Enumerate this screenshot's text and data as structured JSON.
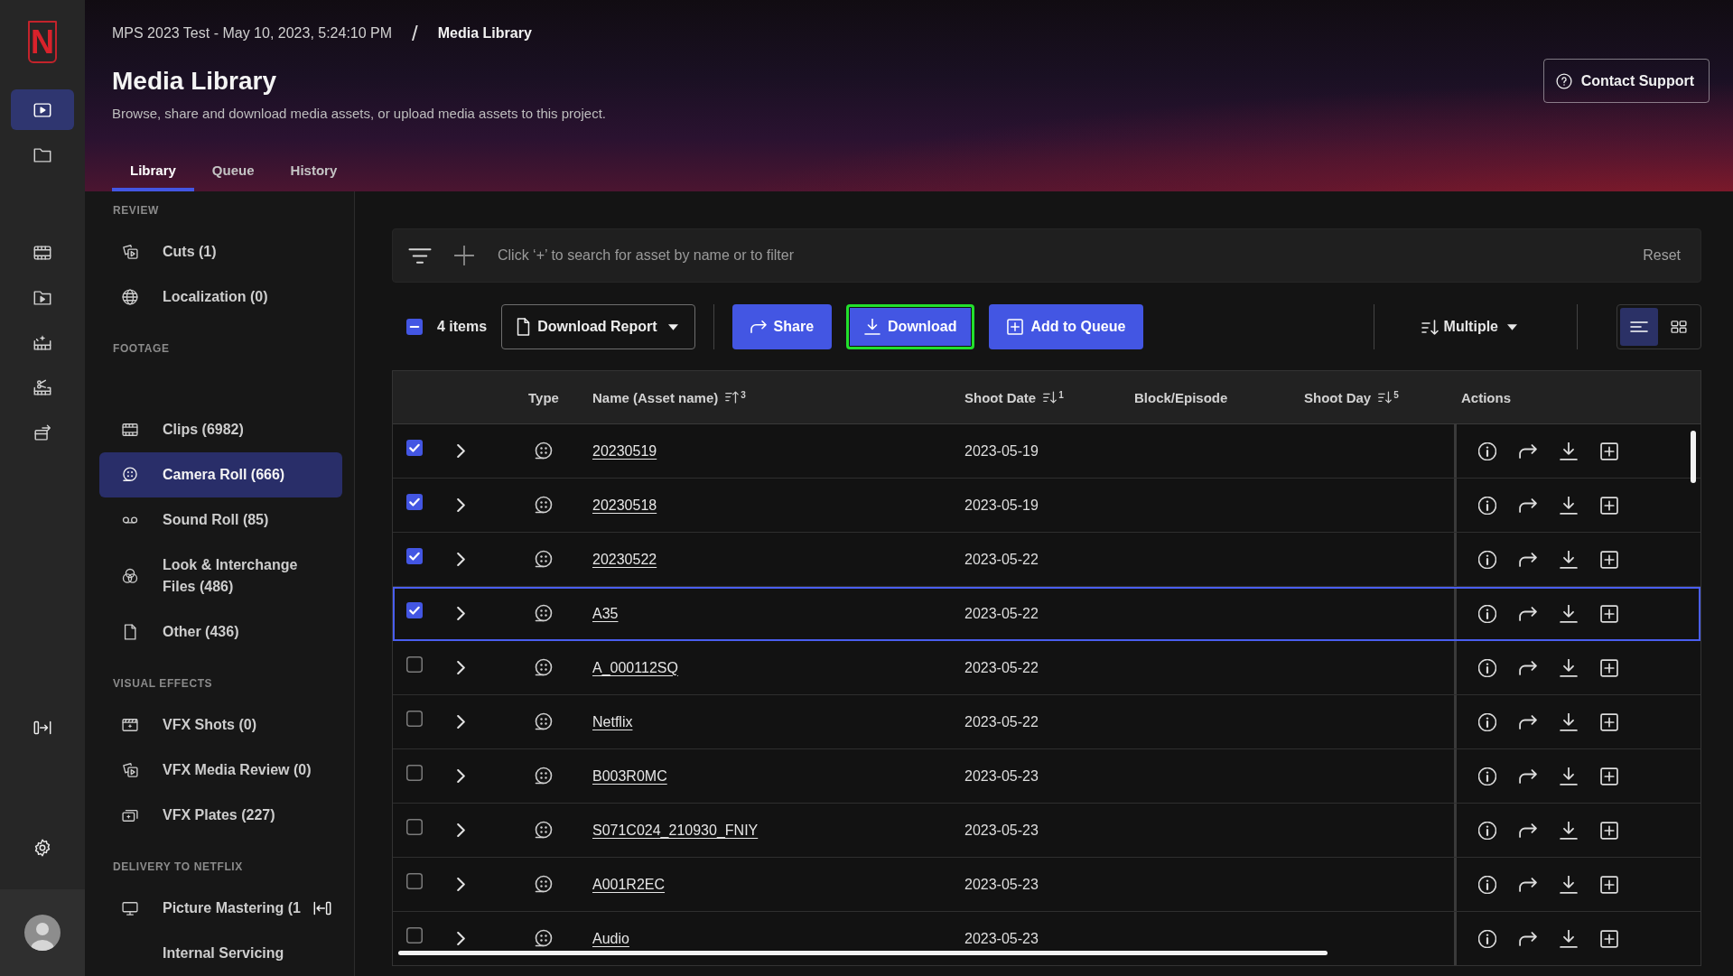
{
  "rail": {
    "logo": "N",
    "top": [
      {
        "kind": "video",
        "selected": true
      },
      {
        "kind": "folder",
        "selected": false
      }
    ],
    "middle": [
      {
        "kind": "film",
        "selected": false
      },
      {
        "kind": "video-folder",
        "selected": false
      },
      {
        "kind": "film-sparkle",
        "selected": false
      },
      {
        "kind": "film-scissors",
        "selected": false
      },
      {
        "kind": "export",
        "selected": false
      }
    ]
  },
  "header": {
    "breadcrumb": {
      "project": "MPS 2023 Test - May 10, 2023, 5:24:10 PM",
      "separator": "/",
      "current": "Media Library"
    },
    "title": "Media Library",
    "subtitle": "Browse, share and download media assets, or upload media assets to this project.",
    "contact_button": "Contact Support",
    "tabs": [
      {
        "label": "Library",
        "selected": true
      },
      {
        "label": "Queue",
        "selected": false
      },
      {
        "label": "History",
        "selected": false
      }
    ]
  },
  "sidebar": {
    "sections": [
      {
        "heading": "REVIEW",
        "items": [
          {
            "label": "Cuts (1)",
            "kind": "stack",
            "selected": false
          },
          {
            "label": "Localization (0)",
            "kind": "globe",
            "selected": false
          }
        ]
      },
      {
        "heading": "FOOTAGE",
        "items": [
          {
            "label": "Clips (6982)",
            "kind": "film",
            "selected": false
          },
          {
            "label": "Camera Roll (666)",
            "kind": "reel",
            "selected": true
          },
          {
            "label": "Sound Roll (85)",
            "kind": "tape",
            "selected": false
          },
          {
            "label": "Look & Interchange Files (486)",
            "kind": "circles",
            "selected": false
          },
          {
            "label": "Other (436)",
            "kind": "file",
            "selected": false
          }
        ]
      },
      {
        "heading": "VISUAL EFFECTS",
        "items": [
          {
            "label": "VFX Shots (0)",
            "kind": "clapper",
            "selected": false
          },
          {
            "label": "VFX Media Review (0)",
            "kind": "stack",
            "selected": false
          },
          {
            "label": "VFX Plates (227)",
            "kind": "layers",
            "selected": false
          }
        ]
      },
      {
        "heading": "DELIVERY TO NETFLIX",
        "items": [
          {
            "label": "Picture Mastering (1",
            "kind": "monitor",
            "selected": false
          },
          {
            "label": "Internal Servicing",
            "selected": false
          }
        ]
      }
    ]
  },
  "filter_bar": {
    "placeholder": "Click ‘+’ to search for asset by name or to filter",
    "reset": "Reset"
  },
  "toolbar": {
    "select_all": {
      "indeterminate": true
    },
    "count": "4 items",
    "report_button": "Download Report",
    "actions": [
      {
        "label": "Share",
        "kind": "share",
        "focused": false
      },
      {
        "label": "Download",
        "kind": "download",
        "focused": true
      },
      {
        "label": "Add to Queue",
        "kind": "add",
        "focused": false
      }
    ],
    "sort_button": "Multiple",
    "views": [
      {
        "kind": "list",
        "selected": true
      },
      {
        "kind": "grid",
        "selected": false
      }
    ]
  },
  "table": {
    "columns": [
      {
        "label": "Type"
      },
      {
        "label": "Name (Asset name)",
        "ascending": true,
        "sort_order": "3"
      },
      {
        "label": "Shoot Date",
        "ascending": false,
        "sort_order": "1"
      },
      {
        "label": "Block/Episode"
      },
      {
        "label": "Shoot Day",
        "ascending": false,
        "sort_order": "5"
      },
      {
        "label": "Actions"
      }
    ],
    "rows": [
      {
        "name": "20230519",
        "shoot_date": "2023-05-19",
        "checked": true,
        "focused": false
      },
      {
        "name": "20230518",
        "shoot_date": "2023-05-19",
        "checked": true,
        "focused": false
      },
      {
        "name": "20230522",
        "shoot_date": "2023-05-22",
        "checked": true,
        "focused": false
      },
      {
        "name": "A35",
        "shoot_date": "2023-05-22",
        "checked": true,
        "focused": true
      },
      {
        "name": "A_000112SQ",
        "shoot_date": "2023-05-22",
        "checked": false,
        "focused": false
      },
      {
        "name": "Netflix",
        "shoot_date": "2023-05-22",
        "checked": false,
        "focused": false
      },
      {
        "name": "B003R0MC",
        "shoot_date": "2023-05-23",
        "checked": false,
        "focused": false
      },
      {
        "name": "S071C024_210930_FNIY",
        "shoot_date": "2023-05-23",
        "checked": false,
        "focused": false
      },
      {
        "name": "A001R2EC",
        "shoot_date": "2023-05-23",
        "checked": false,
        "focused": false
      },
      {
        "name": "Audio",
        "shoot_date": "2023-05-23",
        "checked": false,
        "focused": false
      }
    ]
  }
}
